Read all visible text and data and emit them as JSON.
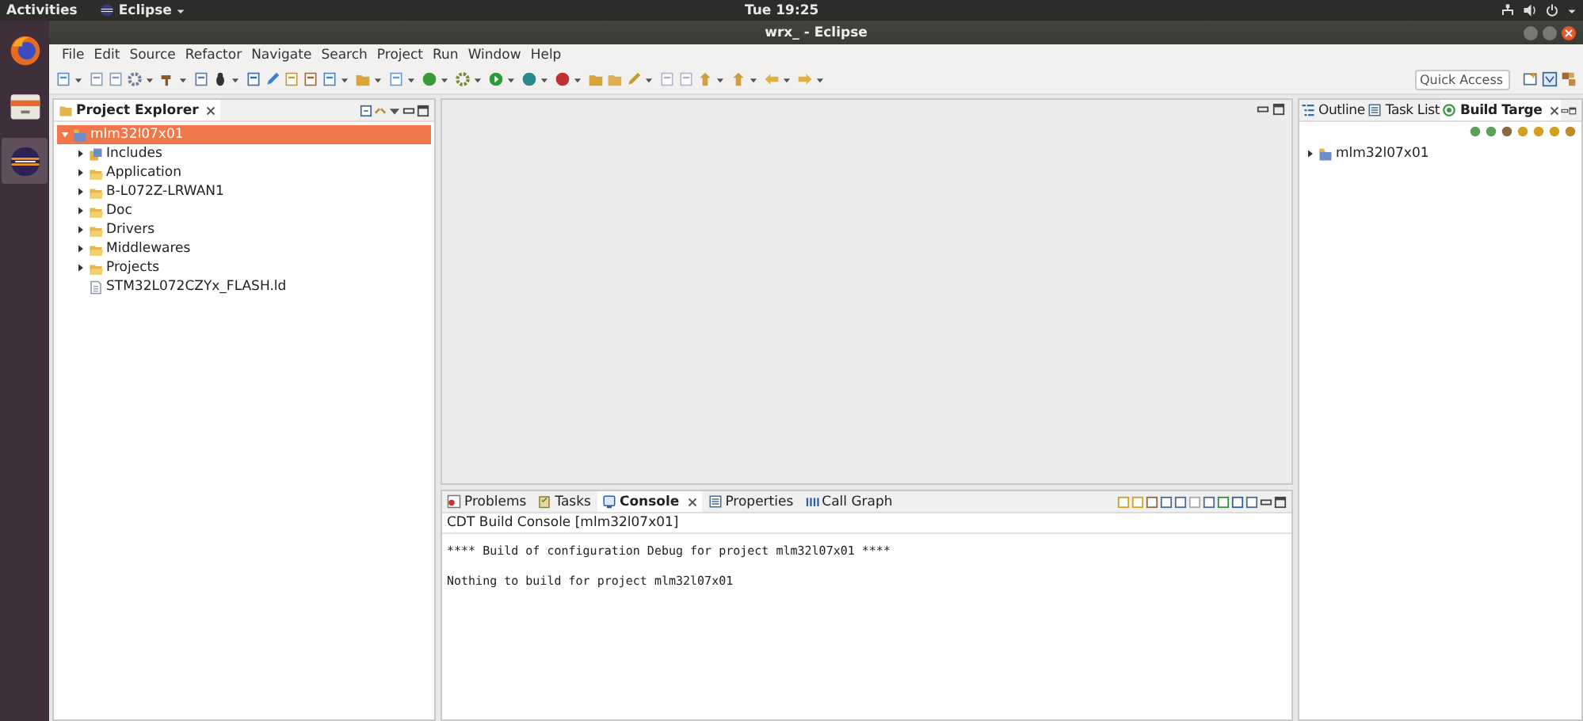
{
  "top_bar": {
    "activities": "Activities",
    "app_menu": "Eclipse",
    "clock": "Tue 19:25"
  },
  "dock": [
    {
      "kind": "browser",
      "selected": false
    },
    {
      "kind": "files",
      "selected": false
    },
    {
      "kind": "eclipse",
      "selected": true
    }
  ],
  "window": {
    "title": "wrx_ - Eclipse"
  },
  "menu": [
    "File",
    "Edit",
    "Source",
    "Refactor",
    "Navigate",
    "Search",
    "Project",
    "Run",
    "Window",
    "Help"
  ],
  "quick_access": {
    "placeholder": "Quick Access"
  },
  "project_explorer": {
    "title": "Project Explorer",
    "tree": [
      {
        "label": "mlm32l07x01",
        "kind": "project",
        "expanded": true,
        "selected": true,
        "children": [
          {
            "label": "Includes",
            "kind": "includes",
            "expanded": false,
            "selected": false
          },
          {
            "label": "Application",
            "kind": "folder",
            "expanded": false,
            "selected": false
          },
          {
            "label": "B-L072Z-LRWAN1",
            "kind": "folder",
            "expanded": false,
            "selected": false
          },
          {
            "label": "Doc",
            "kind": "folder",
            "expanded": false,
            "selected": false
          },
          {
            "label": "Drivers",
            "kind": "folder",
            "expanded": false,
            "selected": false
          },
          {
            "label": "Middlewares",
            "kind": "folder",
            "expanded": false,
            "selected": false
          },
          {
            "label": "Projects",
            "kind": "folder",
            "expanded": false,
            "selected": false
          },
          {
            "label": "STM32L072CZYx_FLASH.ld",
            "kind": "file",
            "selected": false
          }
        ]
      }
    ]
  },
  "right_panel": {
    "tabs": [
      {
        "label": "Outline",
        "kind": "outline",
        "selected": false
      },
      {
        "label": "Task List",
        "kind": "tasklist",
        "selected": false
      },
      {
        "label": "Build Targe",
        "kind": "target",
        "selected": true
      }
    ],
    "tree": [
      {
        "label": "mlm32l07x01",
        "kind": "project",
        "expanded": false,
        "selected": false
      }
    ]
  },
  "bottom_panel": {
    "tabs": [
      {
        "label": "Problems",
        "kind": "problems",
        "selected": false
      },
      {
        "label": "Tasks",
        "kind": "tasks",
        "selected": false
      },
      {
        "label": "Console",
        "kind": "console",
        "selected": true
      },
      {
        "label": "Properties",
        "kind": "properties",
        "selected": false
      },
      {
        "label": "Call Graph",
        "kind": "callgraph",
        "selected": false
      }
    ],
    "console_title": "CDT Build Console [mlm32l07x01]",
    "lines": [
      "**** Build of configuration Debug for project mlm32l07x01 ****",
      "Nothing to build for project mlm32l07x01"
    ]
  }
}
